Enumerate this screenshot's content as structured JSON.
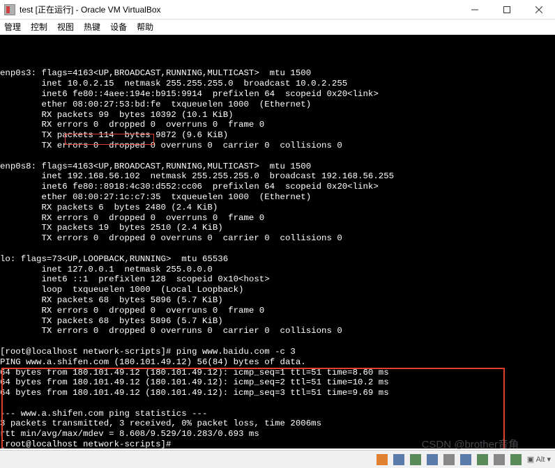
{
  "window": {
    "title": "test [正在运行] - Oracle VM VirtualBox",
    "menus": [
      "管理",
      "控制",
      "视图",
      "热键",
      "设备",
      "帮助"
    ]
  },
  "highlighted_ip": "192.168.56.102",
  "terminal_lines": [
    "enp0s3: flags=4163<UP,BROADCAST,RUNNING,MULTICAST>  mtu 1500",
    "        inet 10.0.2.15  netmask 255.255.255.0  broadcast 10.0.2.255",
    "        inet6 fe80::4aee:194e:b915:9914  prefixlen 64  scopeid 0x20<link>",
    "        ether 08:00:27:53:bd:fe  txqueuelen 1000  (Ethernet)",
    "        RX packets 99  bytes 10392 (10.1 KiB)",
    "        RX errors 0  dropped 0  overruns 0  frame 0",
    "        TX packets 114  bytes 9872 (9.6 KiB)",
    "        TX errors 0  dropped 0 overruns 0  carrier 0  collisions 0",
    "",
    "enp0s8: flags=4163<UP,BROADCAST,RUNNING,MULTICAST>  mtu 1500",
    "        inet 192.168.56.102  netmask 255.255.255.0  broadcast 192.168.56.255",
    "        inet6 fe80::8918:4c30:d552:cc06  prefixlen 64  scopeid 0x20<link>",
    "        ether 08:00:27:1c:c7:35  txqueuelen 1000  (Ethernet)",
    "        RX packets 6  bytes 2480 (2.4 KiB)",
    "        RX errors 0  dropped 0  overruns 0  frame 0",
    "        TX packets 19  bytes 2510 (2.4 KiB)",
    "        TX errors 0  dropped 0 overruns 0  carrier 0  collisions 0",
    "",
    "lo: flags=73<UP,LOOPBACK,RUNNING>  mtu 65536",
    "        inet 127.0.0.1  netmask 255.0.0.0",
    "        inet6 ::1  prefixlen 128  scopeid 0x10<host>",
    "        loop  txqueuelen 1000  (Local Loopback)",
    "        RX packets 68  bytes 5896 (5.7 KiB)",
    "        RX errors 0  dropped 0  overruns 0  frame 0",
    "        TX packets 68  bytes 5896 (5.7 KiB)",
    "        TX errors 0  dropped 0 overruns 0  carrier 0  collisions 0",
    "",
    "[root@localhost network-scripts]# ping www.baidu.com -c 3",
    "PING www.a.shifen.com (180.101.49.12) 56(84) bytes of data.",
    "64 bytes from 180.101.49.12 (180.101.49.12): icmp_seq=1 ttl=51 time=8.60 ms",
    "64 bytes from 180.101.49.12 (180.101.49.12): icmp_seq=2 ttl=51 time=10.2 ms",
    "64 bytes from 180.101.49.12 (180.101.49.12): icmp_seq=3 ttl=51 time=9.69 ms",
    "",
    "--- www.a.shifen.com ping statistics ---",
    "3 packets transmitted, 3 received, 0% packet loss, time 2006ms",
    "rtt min/avg/max/mdev = 8.608/9.529/10.283/0.693 ms",
    "[root@localhost network-scripts]#"
  ],
  "watermark": "CSDN @brother音角"
}
